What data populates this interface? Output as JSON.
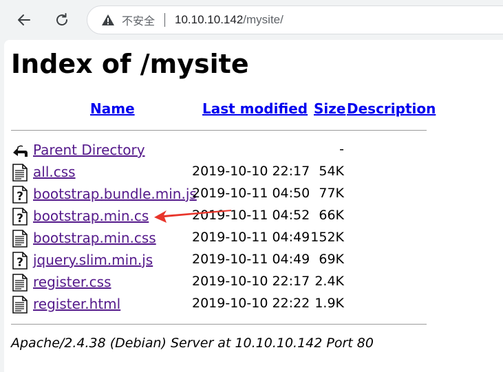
{
  "browser": {
    "security_label": "不安全",
    "url_host": "10.10.10.142",
    "url_path": "/mysite/"
  },
  "page": {
    "title": "Index of /mysite",
    "columns": {
      "name": "Name",
      "last_modified": "Last modified",
      "size": "Size",
      "description": "Description"
    },
    "entries": [
      {
        "icon": "back-icon",
        "name": "Parent Directory",
        "date": "",
        "size": "-"
      },
      {
        "icon": "text-file-icon",
        "name": "all.css",
        "date": "2019-10-10 22:17",
        "size": "54K"
      },
      {
        "icon": "unknown-file-icon",
        "name": "bootstrap.bundle.min.js",
        "date": "2019-10-11 04:50",
        "size": "77K"
      },
      {
        "icon": "unknown-file-icon",
        "name": "bootstrap.min.cs",
        "date": "2019-10-11 04:52",
        "size": "66K"
      },
      {
        "icon": "text-file-icon",
        "name": "bootstrap.min.css",
        "date": "2019-10-11 04:49",
        "size": "152K"
      },
      {
        "icon": "unknown-file-icon",
        "name": "jquery.slim.min.js",
        "date": "2019-10-11 04:49",
        "size": "69K"
      },
      {
        "icon": "text-file-icon",
        "name": "register.css",
        "date": "2019-10-10 22:17",
        "size": "2.4K"
      },
      {
        "icon": "text-file-icon",
        "name": "register.html",
        "date": "2019-10-10 22:22",
        "size": "1.9K"
      }
    ],
    "footer": "Apache/2.4.38 (Debian) Server at 10.10.10.142 Port 80"
  },
  "annotation": {
    "type": "red-arrow",
    "color": "#e8352b",
    "points_to": "bootstrap.min.cs"
  }
}
